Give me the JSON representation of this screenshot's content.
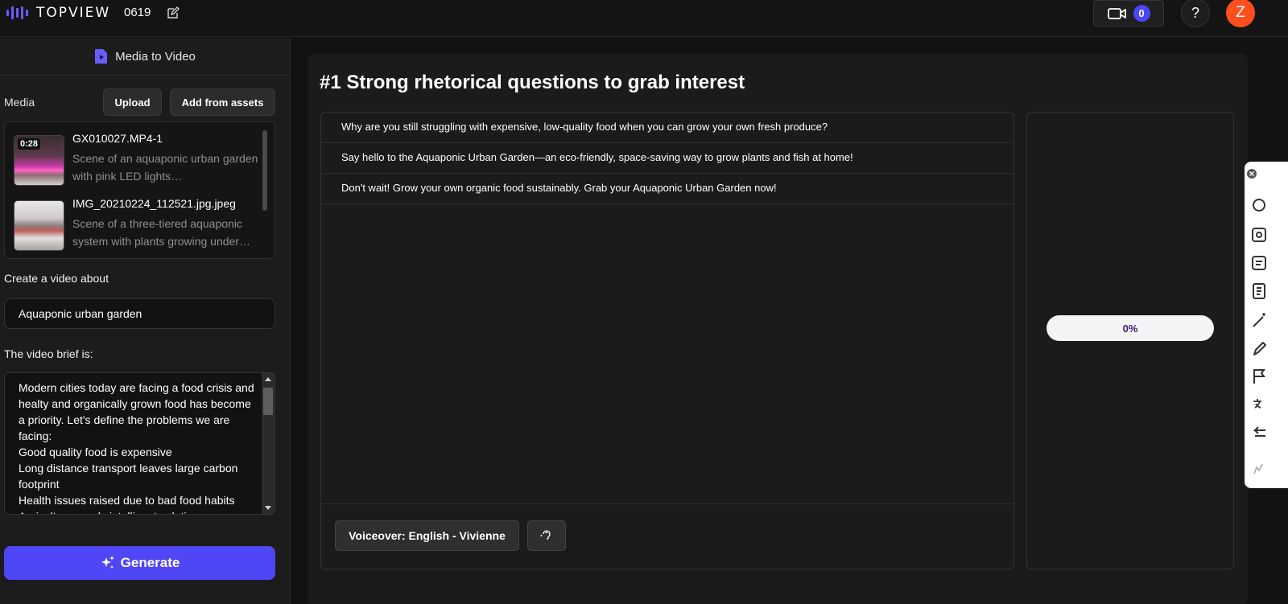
{
  "header": {
    "logo_text": "TOPVIEW",
    "project_name": "0619",
    "video_count": "0",
    "help_label": "?",
    "avatar_initial": "Z"
  },
  "left_panel": {
    "mode_title": "Media to Video",
    "media_label": "Media",
    "upload_label": "Upload",
    "add_assets_label": "Add from assets",
    "media_items": [
      {
        "duration": "0:28",
        "name": "GX010027.MP4-1",
        "description": "Scene of an aquaponic urban garden with pink LED lights…"
      },
      {
        "duration": "",
        "name": "IMG_20210224_112521.jpg.jpeg",
        "description": "Scene of a three-tiered aquaponic system with plants growing under…"
      }
    ],
    "topic_label": "Create a video about",
    "topic_value": "Aquaponic urban garden",
    "brief_label": "The video brief is:",
    "brief_text": "Modern cities today are facing a food crisis and healty and organically grown food has become a priority. Let's define the problems we are facing:\nGood quality food is expensive\nLong distance transport leaves large carbon footprint\nHealth issues raised due to bad food habits\nAgriculture needs intelligent solutions",
    "generate_label": "Generate"
  },
  "main": {
    "title": "#1 Strong rhetorical questions to grab interest",
    "script_lines": [
      "Why are you still struggling with expensive, low-quality food when you can grow your own fresh produce?",
      "Say hello to the Aquaponic Urban Garden—an eco-friendly, space-saving way to grow plants and fish at home!",
      "Don't wait! Grow your own organic food sustainably. Grab your Aquaponic Urban Garden now!"
    ],
    "voiceover_label": "Voiceover: English - Vivienne",
    "progress_text": "0%",
    "progress_value": 0
  },
  "colors": {
    "accent": "#4f46f5",
    "avatar": "#ff4f1f",
    "background": "#121212",
    "panel": "#1c1c1c"
  },
  "icons": [
    "logo-bars-icon",
    "edit-icon",
    "video-camera-icon",
    "file-video-icon",
    "sparkle-icon",
    "speaker-icon",
    "close-icon",
    "search-icon",
    "image-search-icon",
    "notes-icon",
    "document-icon",
    "magic-wand-icon",
    "pen-icon",
    "flag-icon",
    "translate-icon",
    "arrow-left-icon",
    "collapse-icon"
  ]
}
